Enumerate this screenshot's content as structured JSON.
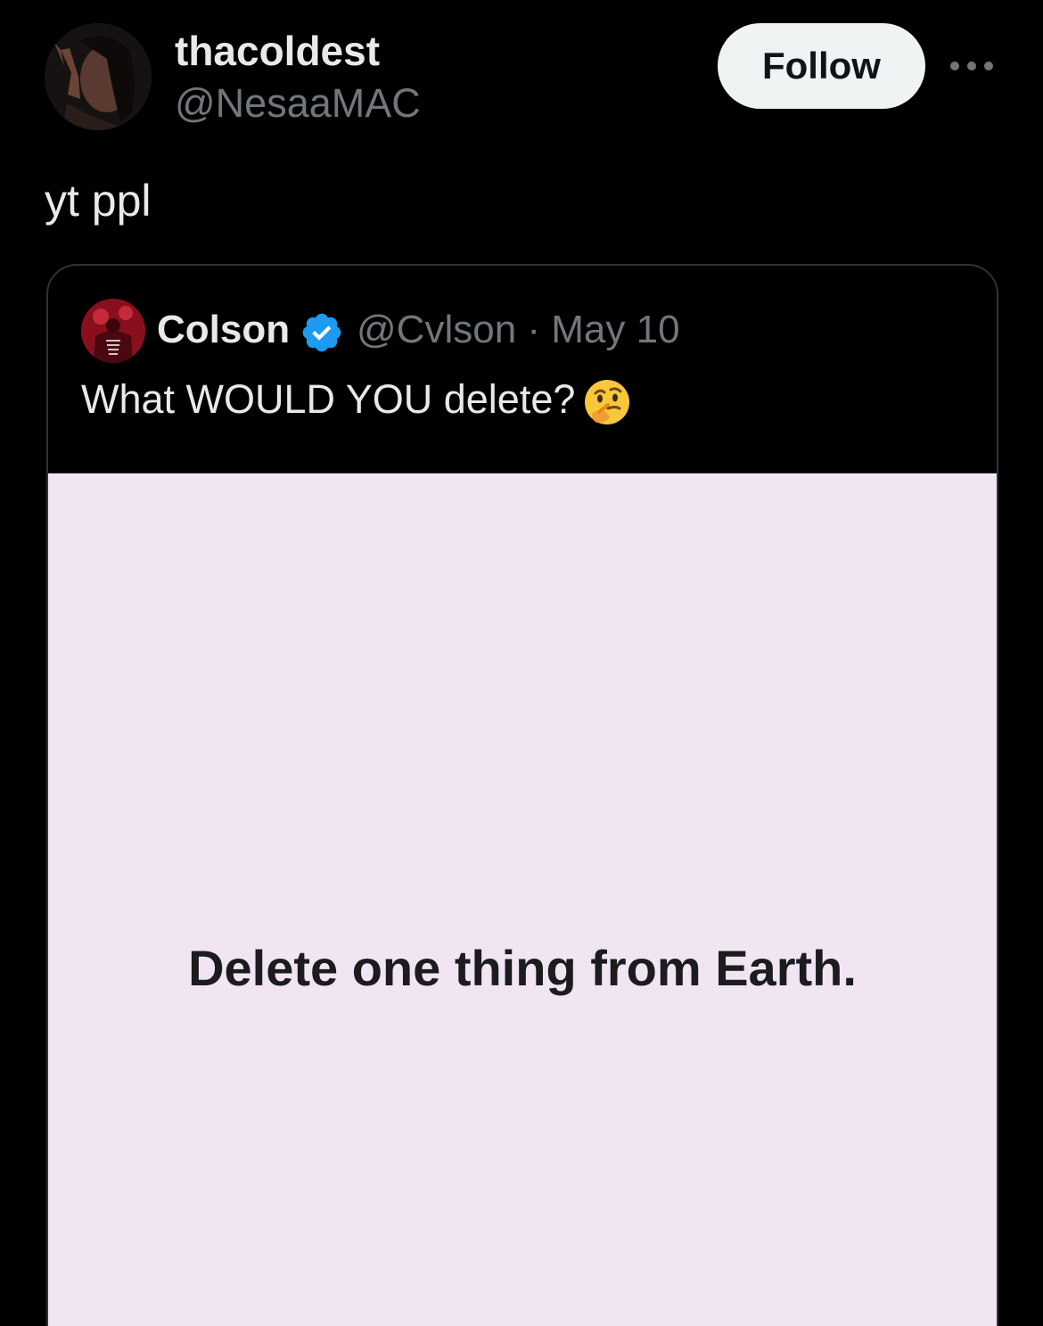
{
  "post": {
    "author": {
      "display_name": "thacoldest",
      "handle": "@NesaaMAC"
    },
    "follow_label": "Follow",
    "more_icon": "more-horizontal-icon",
    "text": "yt ppl"
  },
  "quote": {
    "author": {
      "display_name": "Colson",
      "verified": true,
      "handle": "@Cvlson",
      "date": "May 10"
    },
    "meta": "@Cvlson · May 10",
    "text": "What WOULD YOU delete?",
    "emoji": "thinking-face-icon",
    "media_text": "Delete one thing from Earth."
  },
  "colors": {
    "background": "#000000",
    "primary_text": "#e7e9ea",
    "secondary_text": "#71767b",
    "border": "#2f3336",
    "follow_button_bg": "#eff3f4",
    "verified_blue": "#1d9bf0",
    "media_bg": "#f1e5f4"
  }
}
